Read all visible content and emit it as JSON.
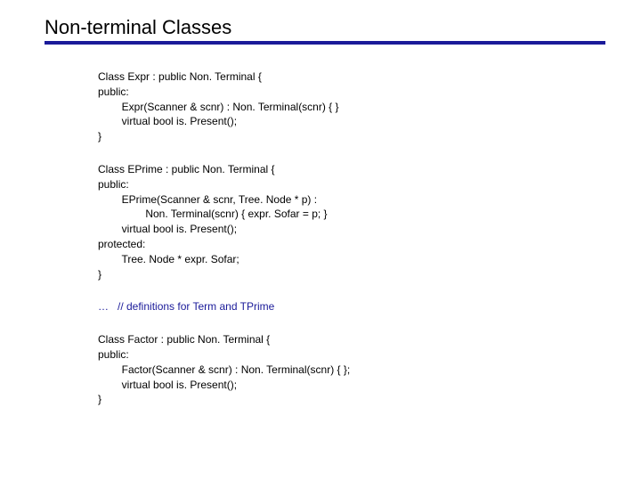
{
  "title": "Non-terminal Classes",
  "code": {
    "expr": {
      "l1": "Class Expr : public Non. Terminal {",
      "l2": "public:",
      "l3": "        Expr(Scanner & scnr) : Non. Terminal(scnr) { }",
      "l4": "        virtual bool is. Present();",
      "l5": "}"
    },
    "eprime": {
      "l1": "Class EPrime : public Non. Terminal {",
      "l2": "public:",
      "l3": "        EPrime(Scanner & scnr, Tree. Node * p) :",
      "l4": "                Non. Terminal(scnr) { expr. Sofar = p; }",
      "l5": "        virtual bool is. Present();",
      "l6": "protected:",
      "l7": "        Tree. Node * expr. Sofar;",
      "l8": "}"
    },
    "note": "…   // definitions for Term and TPrime",
    "factor": {
      "l1": "Class Factor : public Non. Terminal {",
      "l2": "public:",
      "l3": "        Factor(Scanner & scnr) : Non. Terminal(scnr) { };",
      "l4": "        virtual bool is. Present();",
      "l5": "}"
    }
  }
}
